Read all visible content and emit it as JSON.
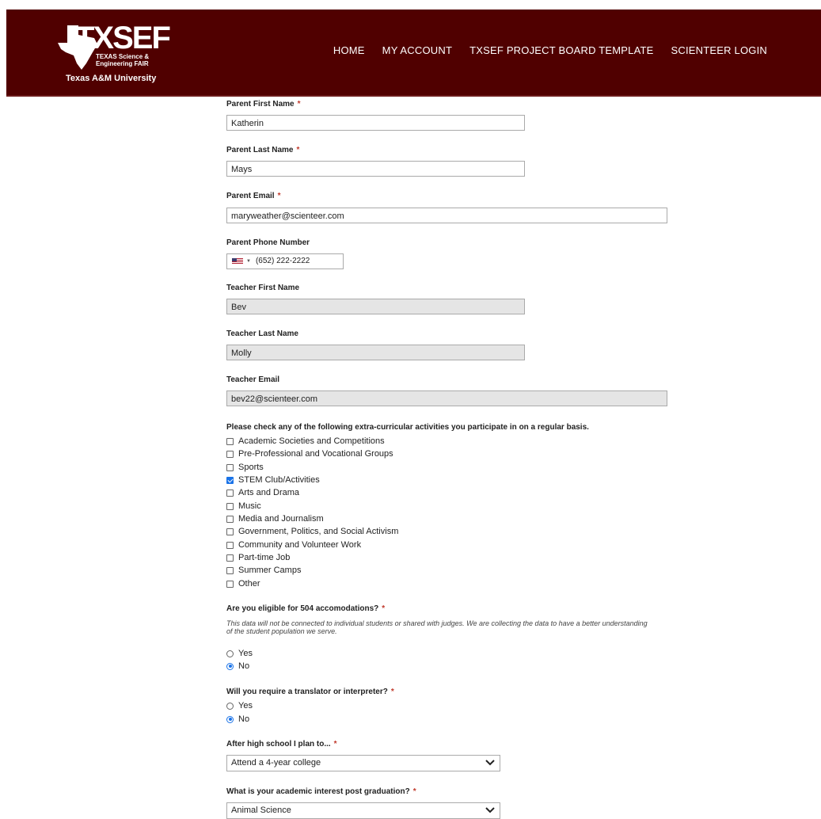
{
  "header": {
    "logo_text": "TXSEF",
    "logo_line1": "TEXAS Science &",
    "logo_line2": "Engineering FAIR",
    "university": "Texas A&M University",
    "nav": [
      "HOME",
      "MY ACCOUNT",
      "TXSEF PROJECT BOARD TEMPLATE",
      "SCIENTEER LOGIN"
    ]
  },
  "form": {
    "parent_first": {
      "label": "Parent First Name",
      "value": "Katherin"
    },
    "parent_last": {
      "label": "Parent Last Name",
      "value": "Mays"
    },
    "parent_email": {
      "label": "Parent Email",
      "value": "maryweather@scienteer.com"
    },
    "parent_phone": {
      "label": "Parent Phone Number",
      "value": "(652) 222-2222"
    },
    "teacher_first": {
      "label": "Teacher First Name",
      "value": "Bev"
    },
    "teacher_last": {
      "label": "Teacher Last Name",
      "value": "Molly"
    },
    "teacher_email": {
      "label": "Teacher Email",
      "value": "bev22@scienteer.com"
    },
    "activities": {
      "label": "Please check any of the following extra-curricular activities you participate in on a regular basis.",
      "options": [
        {
          "label": "Academic Societies and Competitions",
          "checked": false
        },
        {
          "label": "Pre-Professional and Vocational Groups",
          "checked": false
        },
        {
          "label": "Sports",
          "checked": false
        },
        {
          "label": "STEM Club/Activities",
          "checked": true
        },
        {
          "label": "Arts and Drama",
          "checked": false
        },
        {
          "label": "Music",
          "checked": false
        },
        {
          "label": "Media and Journalism",
          "checked": false
        },
        {
          "label": "Government, Politics, and Social Activism",
          "checked": false
        },
        {
          "label": "Community and Volunteer Work",
          "checked": false
        },
        {
          "label": "Part-time Job",
          "checked": false
        },
        {
          "label": "Summer Camps",
          "checked": false
        },
        {
          "label": "Other",
          "checked": false
        }
      ]
    },
    "eligible_504": {
      "label": "Are you eligible for 504 accomodations?",
      "help": "This data will not be connected to individual students or shared with judges. We are collecting the data to have a better understanding of the student population we serve.",
      "options": [
        {
          "label": "Yes",
          "selected": false
        },
        {
          "label": "No",
          "selected": true
        }
      ]
    },
    "translator": {
      "label": "Will you require a translator or interpreter?",
      "options": [
        {
          "label": "Yes",
          "selected": false
        },
        {
          "label": "No",
          "selected": true
        }
      ]
    },
    "plan": {
      "label": "After high school I plan to...",
      "value": "Attend a 4-year college"
    },
    "interest": {
      "label": "What is your academic interest post graduation?",
      "value": "Animal Science"
    },
    "required_mark": "*"
  },
  "colors": {
    "header_bg": "#500000",
    "required": "#c0392b",
    "accent": "#1a73e8"
  }
}
